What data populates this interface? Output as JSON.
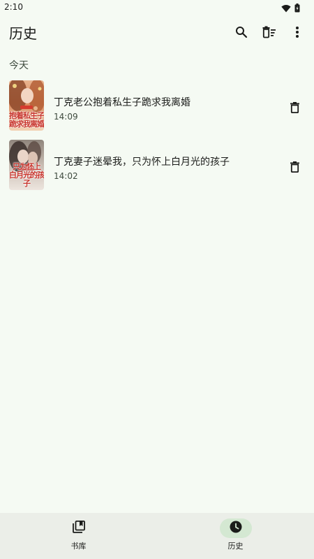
{
  "status_bar": {
    "time": "2:10",
    "icons": [
      "wifi-icon",
      "battery-icon"
    ]
  },
  "header": {
    "title": "历史",
    "actions": [
      {
        "name": "search",
        "icon": "search-icon"
      },
      {
        "name": "clear-history",
        "icon": "delete-sweep-icon"
      },
      {
        "name": "more",
        "icon": "more-vert-icon"
      }
    ]
  },
  "history": {
    "section_label": "今天",
    "items": [
      {
        "title": "丁克老公抱着私生子跪求我离婚",
        "time": "14:09",
        "cover_text": "抱着私生子\n跪求我离婚",
        "delete_icon": "trash-icon"
      },
      {
        "title": "丁克妻子迷晕我，只为怀上白月光的孩子",
        "time": "14:02",
        "cover_text": "只为怀上\n白月光的孩子",
        "delete_icon": "trash-icon"
      }
    ]
  },
  "bottom_nav": {
    "items": [
      {
        "label": "书库",
        "icon": "library-icon",
        "active": false
      },
      {
        "label": "历史",
        "icon": "history-clock-icon",
        "active": true
      }
    ]
  },
  "colors": {
    "background": "#F5FAF3",
    "nav_background": "#EBEEE8",
    "active_indicator": "#D4E8D2",
    "text_primary": "#1B1C1A",
    "text_secondary": "#3E4A3E"
  }
}
